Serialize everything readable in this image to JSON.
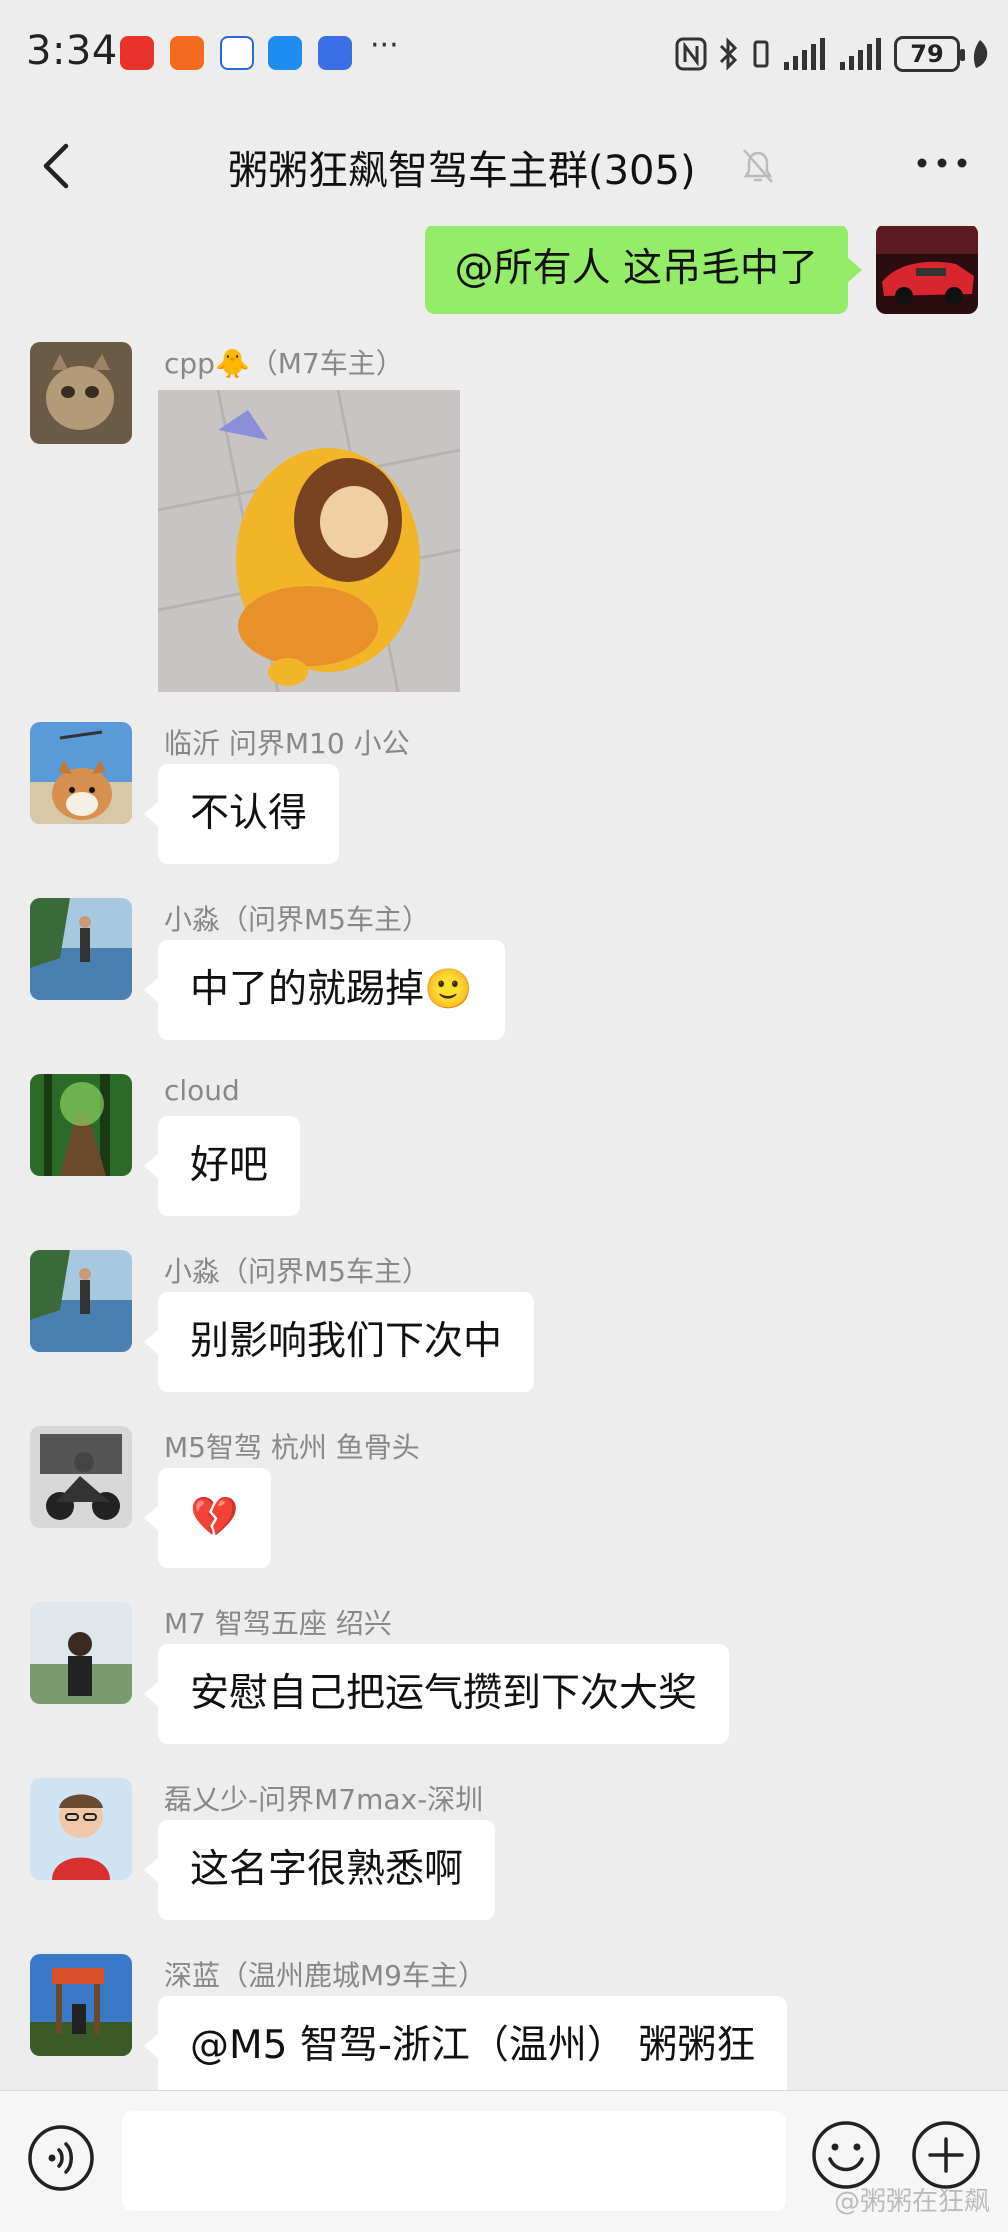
{
  "status_bar": {
    "time": "3:34",
    "more": "···",
    "battery": "79",
    "app_colors": [
      "#e8332c",
      "#f36b21",
      "#ffffff",
      "#1e8cf0",
      "#3c6ee8"
    ]
  },
  "header": {
    "title": "粥粥狂飙智驾车主群(305)",
    "icons": [
      "back-icon",
      "mute-bell-icon",
      "more-icon"
    ]
  },
  "my_message": {
    "text": "@所有人  这吊毛中了"
  },
  "messages": [
    {
      "sender": "cpp🐥（M7车主）",
      "type": "sticker"
    },
    {
      "sender": "临沂  问界M10  小公",
      "text": "不认得"
    },
    {
      "sender": "小淼（问界M5车主）",
      "text": "中了的就踢掉🙂"
    },
    {
      "sender": "cloud",
      "text": "好吧"
    },
    {
      "sender": "小淼（问界M5车主）",
      "text": "别影响我们下次中"
    },
    {
      "sender": "M5智驾  杭州 鱼骨头",
      "text": "💔"
    },
    {
      "sender": "M7 智驾五座 绍兴",
      "text": "安慰自己把运气攒到下次大奖"
    },
    {
      "sender": "磊乂少-问界M7max-深圳",
      "text": "这名字很熟悉啊"
    },
    {
      "sender": "深蓝（温州鹿城M9车主）",
      "text": "@M5 智驾-浙江（温州） 粥粥狂"
    }
  ],
  "input": {
    "placeholder": ""
  },
  "watermark": "@粥粥在狂飙",
  "colors": {
    "background": "#ededed",
    "my_bubble": "#95ec69",
    "other_bubble": "#ffffff"
  }
}
